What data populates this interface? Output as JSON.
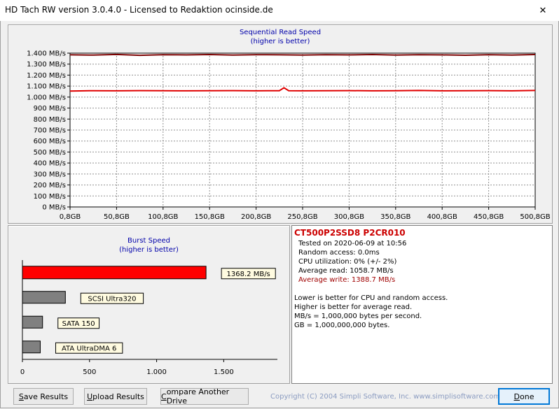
{
  "window": {
    "title": "HD Tach RW version 3.0.4.0 - Licensed to Redaktion ocinside.de",
    "close_symbol": "✕"
  },
  "colors": {
    "read_line": "#e00000",
    "write_line": "#7a0000",
    "burst_bar": "#ff0000",
    "reference_bar": "#808080",
    "title_blue": "#0000aa",
    "drive_name_red": "#cc0000"
  },
  "seq_chart": {
    "title": "Sequential Read Speed",
    "subtitle": "(higher is better)"
  },
  "chart_data": [
    {
      "type": "line",
      "title": "Sequential Read Speed",
      "subtitle": "(higher is better)",
      "grid": true,
      "x_ticks": [
        "0,8GB",
        "50,8GB",
        "100,8GB",
        "150,8GB",
        "200,8GB",
        "250,8GB",
        "300,8GB",
        "350,8GB",
        "400,8GB",
        "450,8GB",
        "500,8GB"
      ],
      "y_ticks": [
        "0 MB/s",
        "100 MB/s",
        "200 MB/s",
        "300 MB/s",
        "400 MB/s",
        "500 MB/s",
        "600 MB/s",
        "700 MB/s",
        "800 MB/s",
        "900 MB/s",
        "1.000 MB/s",
        "1.100 MB/s",
        "1.200 MB/s",
        "1.300 MB/s",
        "1.400 MB/s"
      ],
      "xlim": [
        0.8,
        500.8
      ],
      "ylim": [
        0,
        1400
      ],
      "series": [
        {
          "color": "#7a0000",
          "x": [
            0.8,
            25.8,
            50.8,
            75.8,
            100.8,
            125.8,
            150.8,
            175.8,
            200.8,
            225.8,
            250.8,
            275.8,
            300.8,
            325.8,
            350.8,
            375.8,
            400.8,
            425.8,
            450.8,
            475.8,
            500.8
          ],
          "y": [
            1385,
            1382,
            1388,
            1380,
            1386,
            1384,
            1387,
            1382,
            1386,
            1385,
            1383,
            1386,
            1384,
            1387,
            1382,
            1386,
            1384,
            1381,
            1386,
            1383,
            1387
          ]
        },
        {
          "color": "#e00000",
          "x": [
            0.8,
            25.8,
            50.8,
            75.8,
            100.8,
            125.8,
            150.8,
            175.8,
            200.8,
            225.8,
            230.8,
            235.8,
            250.8,
            275.8,
            300.8,
            325.8,
            350.8,
            375.8,
            400.8,
            425.8,
            450.8,
            475.8,
            500.8
          ],
          "y": [
            1055,
            1058,
            1057,
            1059,
            1058,
            1057,
            1058,
            1059,
            1057,
            1058,
            1085,
            1058,
            1057,
            1058,
            1059,
            1057,
            1058,
            1060,
            1057,
            1058,
            1059,
            1057,
            1060
          ]
        }
      ]
    },
    {
      "type": "bar",
      "orientation": "horizontal",
      "title": "Burst Speed",
      "subtitle": "(higher is better)",
      "x_ticks": [
        "0",
        "500",
        "1.000",
        "1.500"
      ],
      "xlim": [
        0,
        1900
      ],
      "bars": [
        {
          "label": "1368.2 MB/s",
          "value": 1368.2,
          "color": "#ff0000"
        },
        {
          "label": "SCSI Ultra320",
          "value": 320,
          "color": "#808080"
        },
        {
          "label": "SATA 150",
          "value": 150,
          "color": "#808080"
        },
        {
          "label": "ATA UltraDMA 6",
          "value": 133,
          "color": "#808080"
        }
      ]
    }
  ],
  "burst": {
    "title": "Burst Speed",
    "subtitle": "(higher is better)"
  },
  "results": {
    "drive": "CT500P2SSD8 P2CR010",
    "tested": "Tested on 2020-06-09 at 10:56",
    "random_access": "Random access: 0.0ms",
    "cpu": "CPU utilization: 0% (+/- 2%)",
    "avg_read": "Average read: 1058.7 MB/s",
    "avg_write": "Average write: 1388.7 MB/s",
    "note1": "Lower is better for CPU and random access.",
    "note2": "Higher is better for average read.",
    "note3": "MB/s = 1,000,000 bytes per second.",
    "note4": "GB = 1,000,000,000 bytes."
  },
  "buttons": {
    "save": {
      "ul": "S",
      "rest": "ave Results"
    },
    "upload": {
      "ul": "U",
      "rest": "pload Results"
    },
    "compare": {
      "ul": "C",
      "rest": "ompare Another Drive"
    },
    "done": {
      "ul": "D",
      "rest": "one"
    }
  },
  "footer": {
    "copyright": "Copyright (C) 2004 Simpli Software, Inc. www.simplisoftware.com"
  }
}
